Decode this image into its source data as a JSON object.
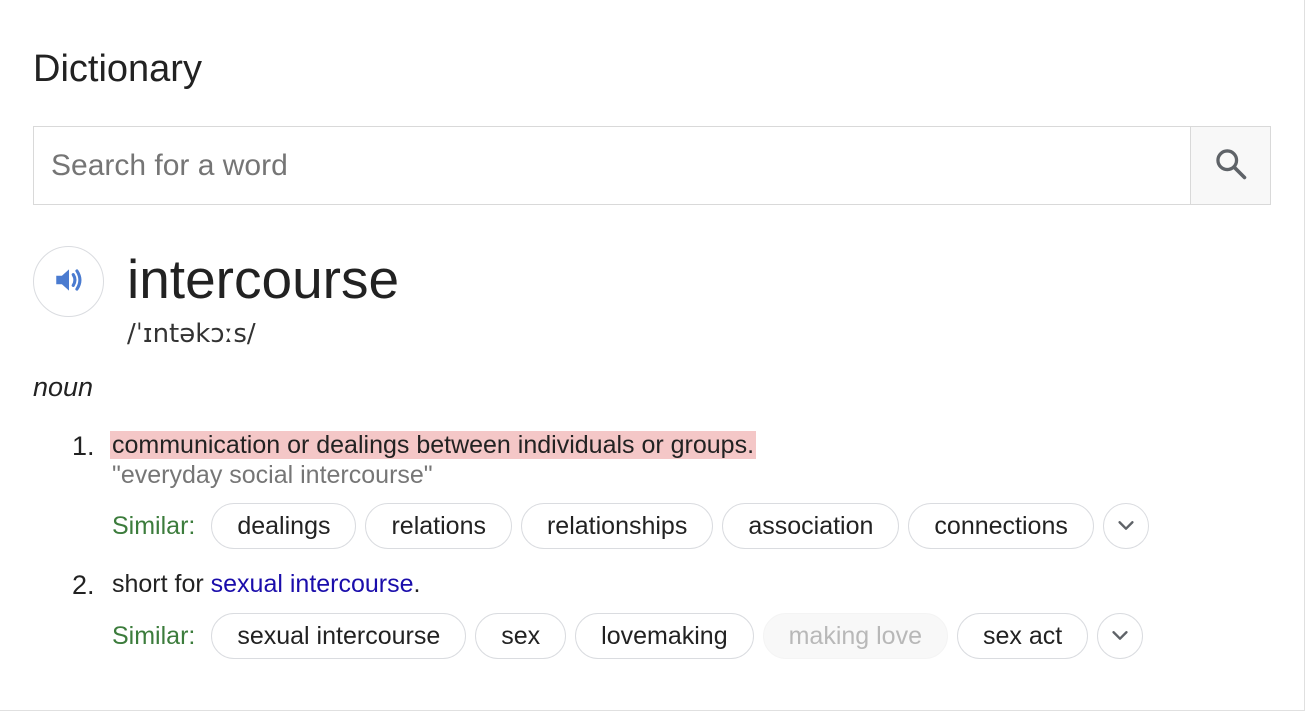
{
  "card": {
    "title": "Dictionary"
  },
  "search": {
    "placeholder": "Search for a word",
    "value": ""
  },
  "entry": {
    "word": "intercourse",
    "phonetic": "/ˈɪntəkɔːs/",
    "part_of_speech": "noun"
  },
  "senses": [
    {
      "number": "1.",
      "definition": "communication or dealings between individuals or groups.",
      "example": "\"everyday social intercourse\"",
      "similar_label": "Similar:",
      "similar": [
        "dealings",
        "relations",
        "relationships",
        "association",
        "connections"
      ]
    },
    {
      "number": "2.",
      "definition_prefix": "short for",
      "definition_link": "sexual intercourse",
      "definition_suffix": ".",
      "similar_label": "Similar:",
      "similar": [
        "sexual intercourse",
        "sex",
        "lovemaking",
        "making love",
        "sex act"
      ]
    }
  ],
  "icons": {
    "search": "search-icon",
    "speaker": "speaker-icon",
    "expand": "chevron-down-icon"
  },
  "colors": {
    "highlight": "#f4c7c7",
    "similar_label": "#3c7c3c",
    "link": "#1a0dab",
    "speaker": "#4a7bd0",
    "example": "#767676"
  }
}
